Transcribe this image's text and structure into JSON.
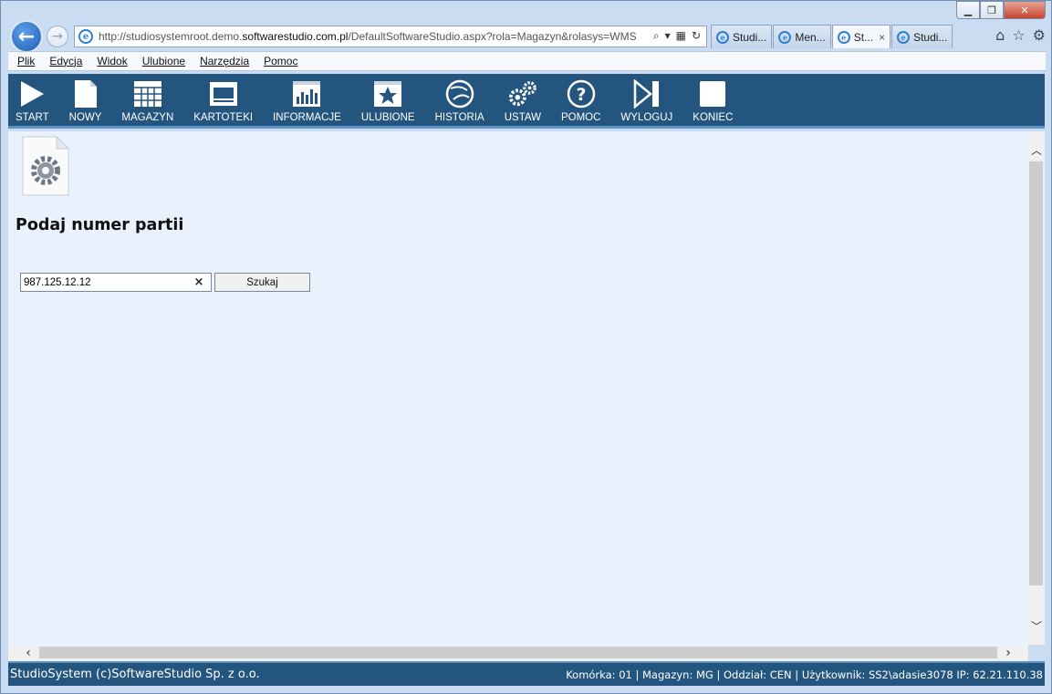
{
  "browser": {
    "url_prefix": "http://studiosystemroot.demo.",
    "url_domain": "softwarestudio.com.pl",
    "url_suffix": "/DefaultSoftwareStudio.aspx?rola=Magazyn&rolasys=WMS",
    "tabs": [
      {
        "label": "Studi...",
        "active": false
      },
      {
        "label": "Men...",
        "active": false
      },
      {
        "label": "St...",
        "active": true
      },
      {
        "label": "Studi...",
        "active": false
      }
    ],
    "tab_close": "×"
  },
  "menu": [
    "Plik",
    "Edycja",
    "Widok",
    "Ulubione",
    "Narzędzia",
    "Pomoc"
  ],
  "toolbar": [
    {
      "label": "START",
      "icon": "play-icon"
    },
    {
      "label": "NOWY",
      "icon": "new-document-icon"
    },
    {
      "label": "MAGAZYN",
      "icon": "warehouse-grid-icon"
    },
    {
      "label": "KARTOTEKI",
      "icon": "card-index-icon"
    },
    {
      "label": "INFORMACJE",
      "icon": "bar-chart-icon"
    },
    {
      "label": "ULUBIONE",
      "icon": "star-icon"
    },
    {
      "label": "HISTORIA",
      "icon": "history-icon"
    },
    {
      "label": "USTAW",
      "icon": "gears-icon"
    },
    {
      "label": "POMOC",
      "icon": "help-icon"
    },
    {
      "label": "WYLOGUJ",
      "icon": "logout-icon"
    },
    {
      "label": "KONIEC",
      "icon": "stop-icon"
    }
  ],
  "page": {
    "heading": "Podaj numer partii",
    "search_value": "987.125.12.12",
    "clear_label": "×",
    "search_button": "Szukaj"
  },
  "status": {
    "left": "StudioSystem (c)SoftwareStudio Sp. z o.o.",
    "right": "Komórka: 01 | Magazyn: MG | Oddział: CEN | Użytkownik: SS2\\adasie3078 IP: 62.21.110.38"
  },
  "colors": {
    "toolbar_bg": "#23557e",
    "content_bg": "#e9f1fc",
    "accent": "#5e94c3"
  }
}
